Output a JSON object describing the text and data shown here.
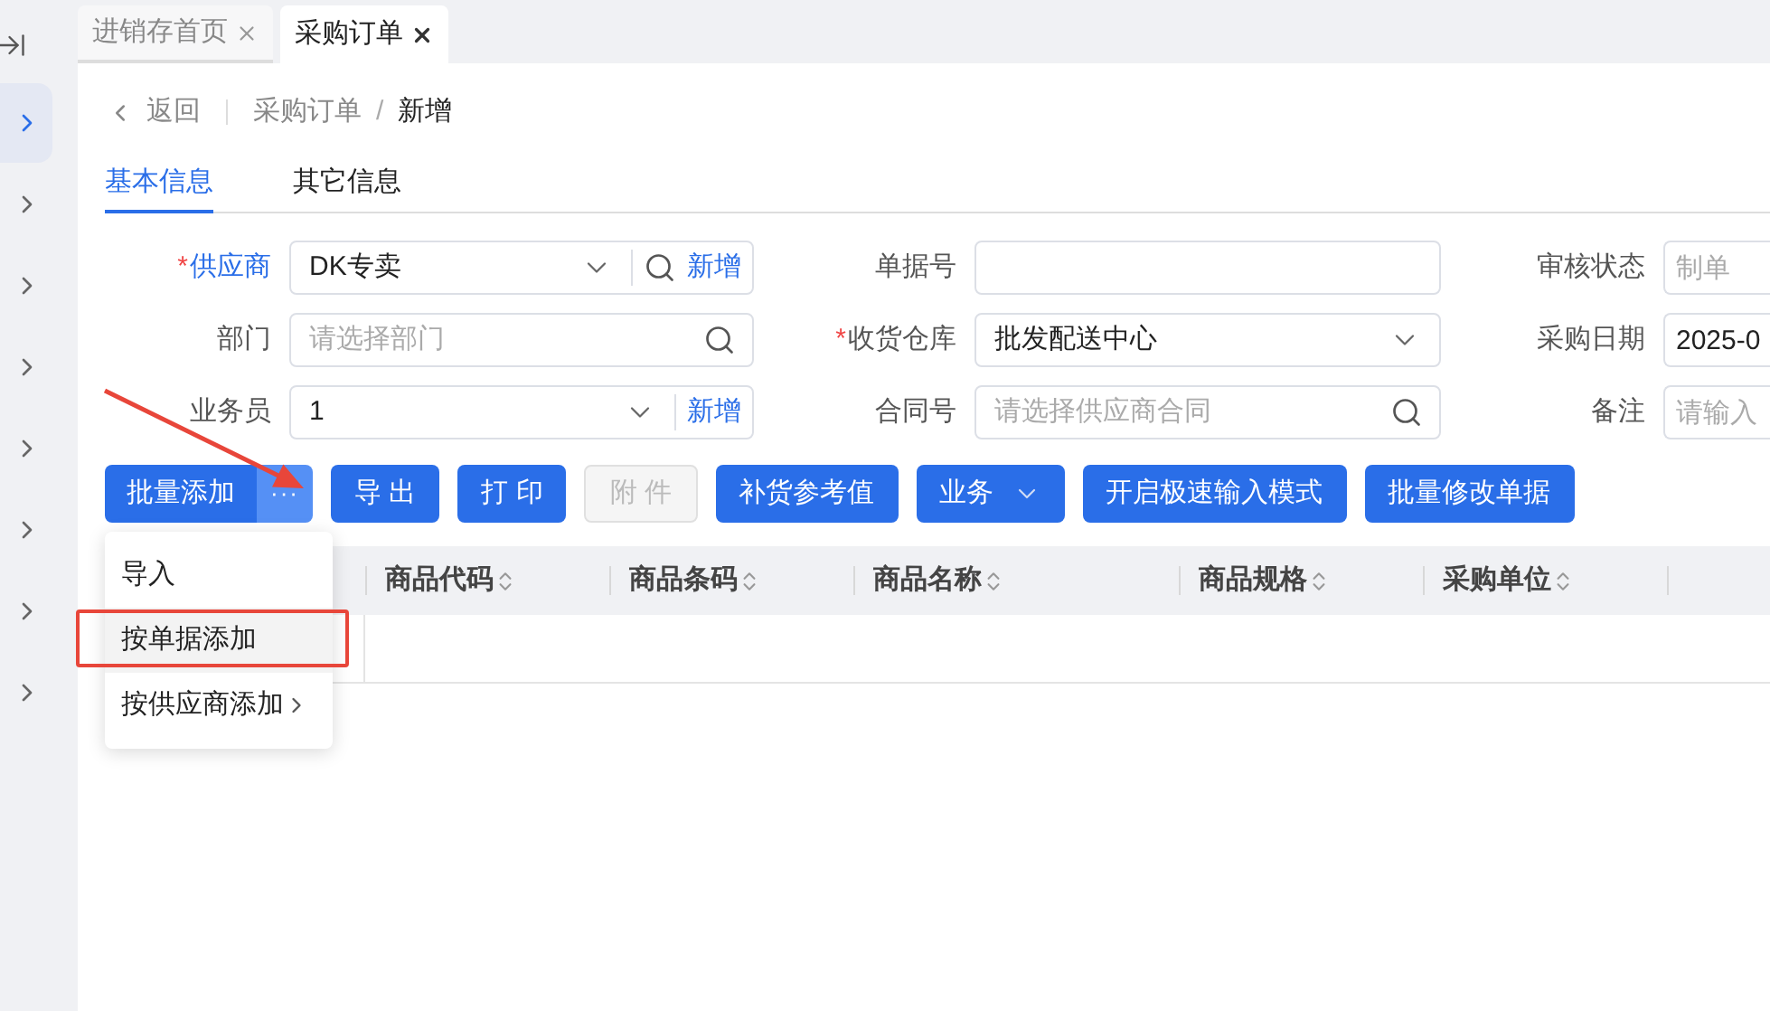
{
  "sidebar": {
    "items": [
      {
        "selected": true
      },
      {
        "selected": false
      },
      {
        "selected": false
      },
      {
        "selected": false
      },
      {
        "selected": false
      },
      {
        "selected": false
      },
      {
        "selected": false
      },
      {
        "selected": false
      }
    ]
  },
  "tabs": [
    {
      "label": "进销存首页",
      "selected": false
    },
    {
      "label": "采购订单",
      "selected": true
    }
  ],
  "breadcrumb": {
    "back": "返回",
    "path": [
      "采购订单",
      "新增"
    ],
    "separator": "/"
  },
  "form_tabs": [
    {
      "label": "基本信息",
      "selected": true
    },
    {
      "label": "其它信息",
      "selected": false
    }
  ],
  "form": {
    "required_mark": "*",
    "fields": [
      {
        "label": "供应商",
        "required": true,
        "kind": "select_search",
        "value": "DK专卖",
        "add_link": "新增"
      },
      {
        "label": "单据号",
        "required": false,
        "kind": "text"
      },
      {
        "label": "审核状态",
        "required": false,
        "kind": "text",
        "placeholder": "制单"
      },
      {
        "label": "部门",
        "required": false,
        "kind": "search",
        "placeholder": "请选择部门"
      },
      {
        "label": "收货仓库",
        "required": true,
        "kind": "select",
        "value": "批发配送中心"
      },
      {
        "label": "采购日期",
        "required": false,
        "kind": "text",
        "value": "2025-0"
      },
      {
        "label": "业务员",
        "required": false,
        "kind": "select_add",
        "value": "1",
        "add_link": "新增"
      },
      {
        "label": "合同号",
        "required": false,
        "kind": "search",
        "placeholder": "请选择供应商合同"
      },
      {
        "label": "备注",
        "required": false,
        "kind": "text",
        "placeholder": "请输入"
      }
    ]
  },
  "toolbar": {
    "buttons": [
      {
        "label": "批量添加",
        "kind": "split",
        "more": "···",
        "disabled": false
      },
      {
        "label": "导 出",
        "kind": "plain",
        "disabled": false
      },
      {
        "label": "打 印",
        "kind": "plain",
        "disabled": false
      },
      {
        "label": "附 件",
        "kind": "plain",
        "disabled": true
      },
      {
        "label": "补货参考值",
        "kind": "plain",
        "disabled": false
      },
      {
        "label": "业务",
        "kind": "dropdown",
        "disabled": false
      },
      {
        "label": "开启极速输入模式",
        "kind": "plain",
        "disabled": false
      },
      {
        "label": "批量修改单据",
        "kind": "plain",
        "disabled": false
      }
    ]
  },
  "table": {
    "columns": [
      "商品代码",
      "商品条码",
      "商品名称",
      "商品规格",
      "采购单位"
    ]
  },
  "menu": {
    "items": [
      {
        "label": "导入",
        "selected": false,
        "submenu": false
      },
      {
        "label": "按单据添加",
        "selected": true,
        "submenu": false
      },
      {
        "label": "按供应商添加",
        "selected": false,
        "submenu": true
      }
    ]
  }
}
